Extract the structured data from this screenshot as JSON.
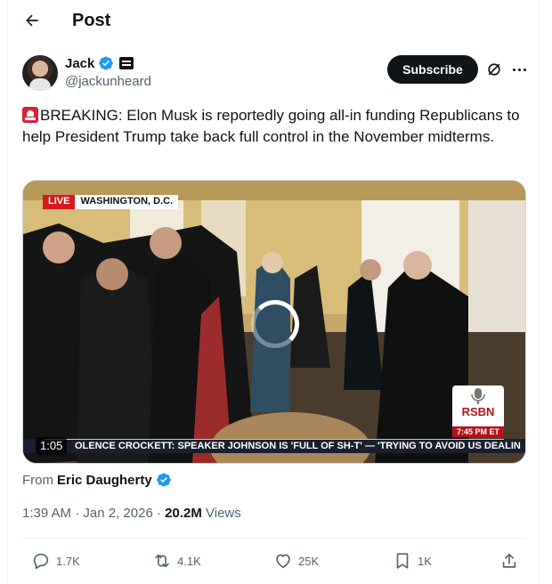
{
  "header": {
    "title": "Post"
  },
  "author": {
    "name": "Jack",
    "handle": "@jackunheard"
  },
  "buttons": {
    "subscribe": "Subscribe"
  },
  "tweet": {
    "text": "BREAKING: Elon Musk is reportedly going all-in funding Republicans to help President Trump take back full control in the November midterms."
  },
  "media": {
    "live_label": "LIVE",
    "location": "WASHINGTON, D.C.",
    "network": "RSBN",
    "time": "7:45 PM ET",
    "ticker": "OLENCE    CROCKETT: SPEAKER JOHNSON IS 'FULL OF SH-T' — 'TRYING TO AVOID US DEALIN",
    "duration": "1:05"
  },
  "source": {
    "prefix": "From",
    "name": "Eric Daugherty"
  },
  "meta": {
    "time": "1:39 AM",
    "separator": "·",
    "date": "Jan 2, 2026",
    "views_count": "20.2M",
    "views_label": "Views"
  },
  "actions": {
    "replies": "1.7K",
    "reposts": "4.1K",
    "likes": "25K",
    "bookmarks": "1K"
  },
  "colors": {
    "accent": "#1d9bf0",
    "text": "#0f1419",
    "secondary": "#536471"
  }
}
